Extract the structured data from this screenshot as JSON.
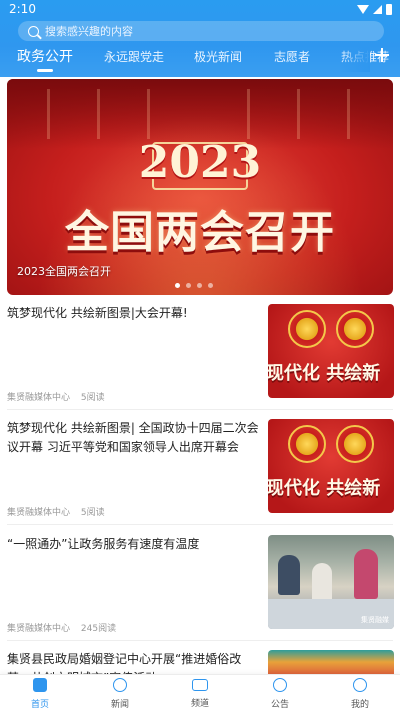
{
  "status_bar": {
    "time": "2:10"
  },
  "search": {
    "placeholder": "搜索感兴趣的内容"
  },
  "tabs": [
    {
      "label": "政务公开",
      "active": true
    },
    {
      "label": "永远跟党走"
    },
    {
      "label": "极光新闻"
    },
    {
      "label": "志愿者"
    },
    {
      "label": "热点推荐"
    }
  ],
  "banner": {
    "year": "2023",
    "headline": "全国两会召开",
    "caption": "2023全国两会召开",
    "slide_count": 4,
    "active_slide": 1
  },
  "news": [
    {
      "title": "筑梦现代化 共绘新图景|大会开幕!",
      "source": "集贤融媒体中心",
      "reads": "5阅读",
      "thumb_text": "现代化 共绘新"
    },
    {
      "title": "筑梦现代化 共绘新图景| 全国政协十四届二次会议开幕 习近平等党和国家领导人出席开幕会",
      "source": "集贤融媒体中心",
      "reads": "5阅读",
      "thumb_text": "现代化 共绘新"
    },
    {
      "title": "“一照通办”让政务服务有速度有温度",
      "source": "集贤融媒体中心",
      "reads": "245阅读",
      "thumb_watermark": "集贤融媒"
    },
    {
      "title": "集贤县民政局婚姻登记中心开展“推进婚俗改革，共创文明城市”宣传活动"
    }
  ],
  "bottom_nav": [
    {
      "label": "首页",
      "icon": "home-icon",
      "active": true
    },
    {
      "label": "新闻",
      "icon": "news-icon"
    },
    {
      "label": "频道",
      "icon": "channel-icon"
    },
    {
      "label": "公告",
      "icon": "announcement-icon"
    },
    {
      "label": "我的",
      "icon": "profile-icon"
    }
  ],
  "colors": {
    "accent": "#2e95ee",
    "header": "#2f97ef",
    "banner_red": "#c51f1d"
  }
}
